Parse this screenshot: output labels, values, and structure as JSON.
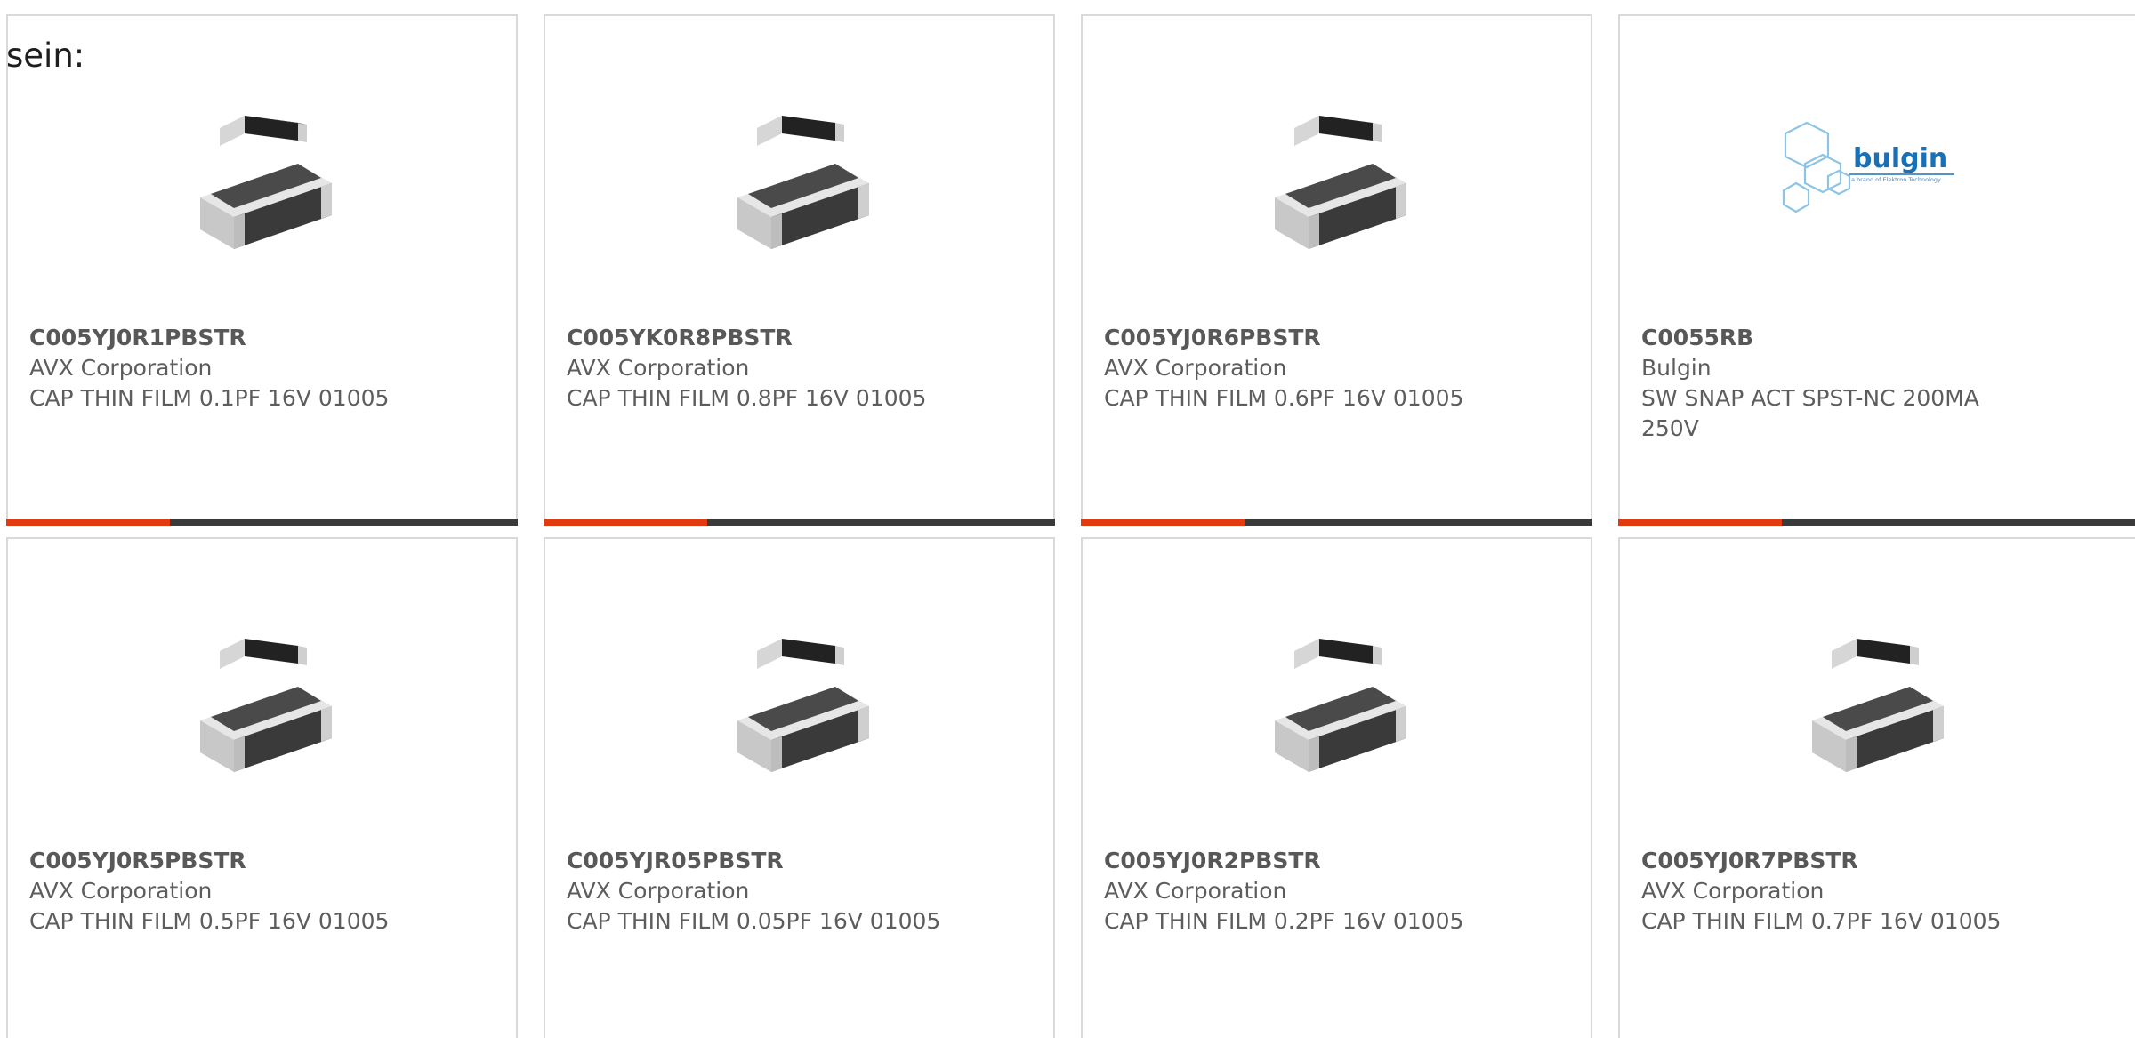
{
  "fragment_text": "sein:",
  "colors": {
    "accent": "#e23b10",
    "bar_dark": "#3a3a3a",
    "border": "#d9d9d9",
    "text": "#5d5d5d"
  },
  "cards": [
    {
      "part": "C005YJ0R1PBSTR",
      "manufacturer": "AVX Corporation",
      "description": "CAP THIN FILM 0.1PF 16V 01005",
      "image": "chip-capacitor-icon"
    },
    {
      "part": "C005YK0R8PBSTR",
      "manufacturer": "AVX Corporation",
      "description": "CAP THIN FILM 0.8PF 16V 01005",
      "image": "chip-capacitor-icon"
    },
    {
      "part": "C005YJ0R6PBSTR",
      "manufacturer": "AVX Corporation",
      "description": "CAP THIN FILM 0.6PF 16V 01005",
      "image": "chip-capacitor-icon"
    },
    {
      "part": "C0055RB",
      "manufacturer": "Bulgin",
      "description": "SW SNAP ACT SPST-NC 200MA 250V",
      "image": "bulgin-logo",
      "logo_text": "bulgin",
      "logo_tagline": "a brand of Elektron Technology"
    },
    {
      "part": "C005YJ0R5PBSTR",
      "manufacturer": "AVX Corporation",
      "description": "CAP THIN FILM 0.5PF 16V 01005",
      "image": "chip-capacitor-icon"
    },
    {
      "part": "C005YJR05PBSTR",
      "manufacturer": "AVX Corporation",
      "description": "CAP THIN FILM 0.05PF 16V 01005",
      "image": "chip-capacitor-icon"
    },
    {
      "part": "C005YJ0R2PBSTR",
      "manufacturer": "AVX Corporation",
      "description": "CAP THIN FILM 0.2PF 16V 01005",
      "image": "chip-capacitor-icon"
    },
    {
      "part": "C005YJ0R7PBSTR",
      "manufacturer": "AVX Corporation",
      "description": "CAP THIN FILM 0.7PF 16V 01005",
      "image": "chip-capacitor-icon"
    }
  ]
}
